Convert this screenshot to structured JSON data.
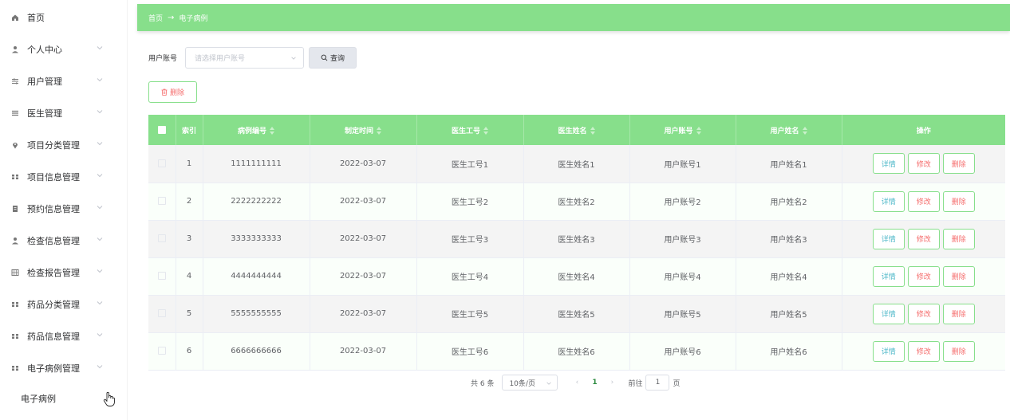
{
  "sidebar": {
    "items": [
      {
        "label": "首页",
        "icon": "home-icon"
      },
      {
        "label": "个人中心",
        "icon": "user-icon"
      },
      {
        "label": "用户管理",
        "icon": "sliders-icon"
      },
      {
        "label": "医生管理",
        "icon": "menu-lines-icon"
      },
      {
        "label": "项目分类管理",
        "icon": "location-pin-icon"
      },
      {
        "label": "项目信息管理",
        "icon": "grid-icon"
      },
      {
        "label": "预约信息管理",
        "icon": "document-icon"
      },
      {
        "label": "检查信息管理",
        "icon": "user-icon"
      },
      {
        "label": "检查报告管理",
        "icon": "table-icon"
      },
      {
        "label": "药品分类管理",
        "icon": "grid-icon"
      },
      {
        "label": "药品信息管理",
        "icon": "grid-icon"
      },
      {
        "label": "电子病例管理",
        "icon": "grid-icon"
      }
    ],
    "submenu": {
      "label": "电子病例"
    }
  },
  "breadcrumb": {
    "home": "首页",
    "separator": "→",
    "current": "电子病例"
  },
  "search": {
    "label": "用户账号",
    "placeholder": "请选择用户账号",
    "query_label": "查询"
  },
  "toolbar": {
    "delete_label": "删除"
  },
  "table": {
    "headers": [
      "索引",
      "病例编号",
      "制定时间",
      "医生工号",
      "医生姓名",
      "用户账号",
      "用户姓名",
      "操作"
    ],
    "rows": [
      [
        "1",
        "1111111111",
        "2022-03-07",
        "医生工号1",
        "医生姓名1",
        "用户账号1",
        "用户姓名1"
      ],
      [
        "2",
        "2222222222",
        "2022-03-07",
        "医生工号2",
        "医生姓名2",
        "用户账号2",
        "用户姓名2"
      ],
      [
        "3",
        "3333333333",
        "2022-03-07",
        "医生工号3",
        "医生姓名3",
        "用户账号3",
        "用户姓名3"
      ],
      [
        "4",
        "4444444444",
        "2022-03-07",
        "医生工号4",
        "医生姓名4",
        "用户账号4",
        "用户姓名4"
      ],
      [
        "5",
        "5555555555",
        "2022-03-07",
        "医生工号5",
        "医生姓名5",
        "用户账号5",
        "用户姓名5"
      ],
      [
        "6",
        "6666666666",
        "2022-03-07",
        "医生工号6",
        "医生姓名6",
        "用户账号6",
        "用户姓名6"
      ]
    ],
    "actions": {
      "detail": "详情",
      "edit": "修改",
      "delete": "删除"
    }
  },
  "pagination": {
    "total": "共 6 条",
    "page_size": "10条/页",
    "current_page": "1",
    "goto_prefix": "前往",
    "goto_value": "1",
    "goto_suffix": "页"
  },
  "colors": {
    "accent": "#87df8b",
    "danger": "#f56c6c",
    "info": "#4fb8c9"
  }
}
